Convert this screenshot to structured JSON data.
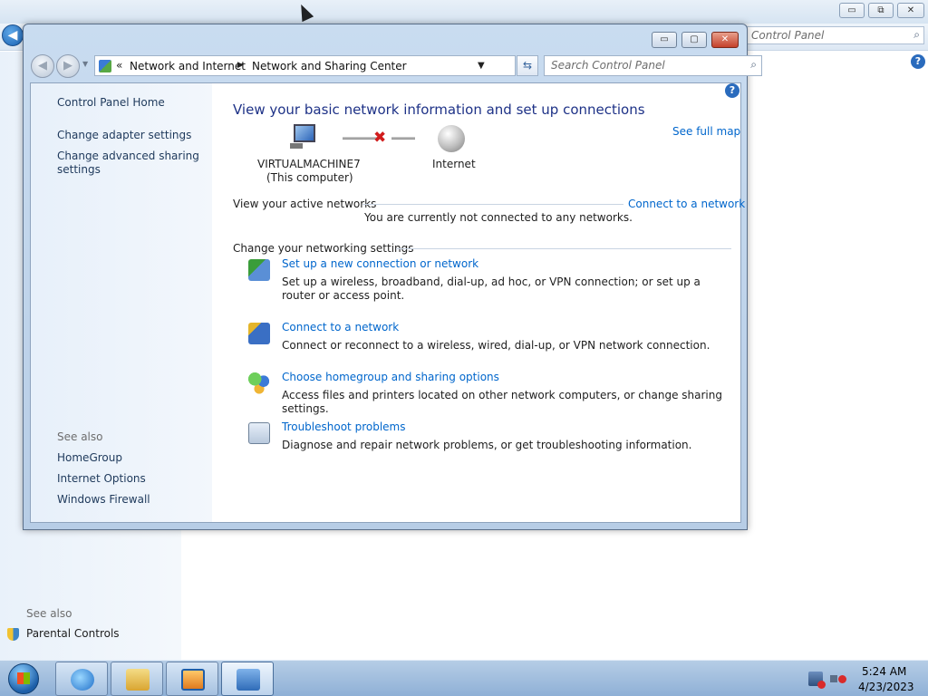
{
  "background_window": {
    "search_placeholder": "Control Panel",
    "see_also": "See also",
    "parental_controls": "Parental Controls",
    "caption_min": "▭",
    "caption_max": "⧉",
    "caption_close": "✕"
  },
  "window": {
    "caption_min": "▭",
    "caption_max": "▢",
    "caption_close": "✕",
    "address": {
      "chevron": "«",
      "crumbs": [
        "Network and Internet",
        "Network and Sharing Center"
      ]
    },
    "search_placeholder": "Search Control Panel"
  },
  "left_pane": {
    "home": "Control Panel Home",
    "tasks": [
      "Change adapter settings",
      "Change advanced sharing settings"
    ],
    "see_also_heading": "See also",
    "see_also": [
      "HomeGroup",
      "Internet Options",
      "Windows Firewall"
    ]
  },
  "content": {
    "heading": "View your basic network information and set up connections",
    "see_full_map": "See full map",
    "computer_name": "VIRTUALMACHINE7",
    "computer_sub": "(This computer)",
    "internet": "Internet",
    "active_networks_label": "View your active networks",
    "connect_link": "Connect to a network",
    "not_connected": "You are currently not connected to any networks.",
    "settings_label": "Change your networking settings",
    "tasks": [
      {
        "title": "Set up a new connection or network",
        "desc": "Set up a wireless, broadband, dial-up, ad hoc, or VPN connection; or set up a router or access point."
      },
      {
        "title": "Connect to a network",
        "desc": "Connect or reconnect to a wireless, wired, dial-up, or VPN network connection."
      },
      {
        "title": "Choose homegroup and sharing options",
        "desc": "Access files and printers located on other network computers, or change sharing settings."
      },
      {
        "title": "Troubleshoot problems",
        "desc": "Diagnose and repair network problems, or get troubleshooting information."
      }
    ]
  },
  "taskbar": {
    "time": "5:24 AM",
    "date": "4/23/2023"
  }
}
